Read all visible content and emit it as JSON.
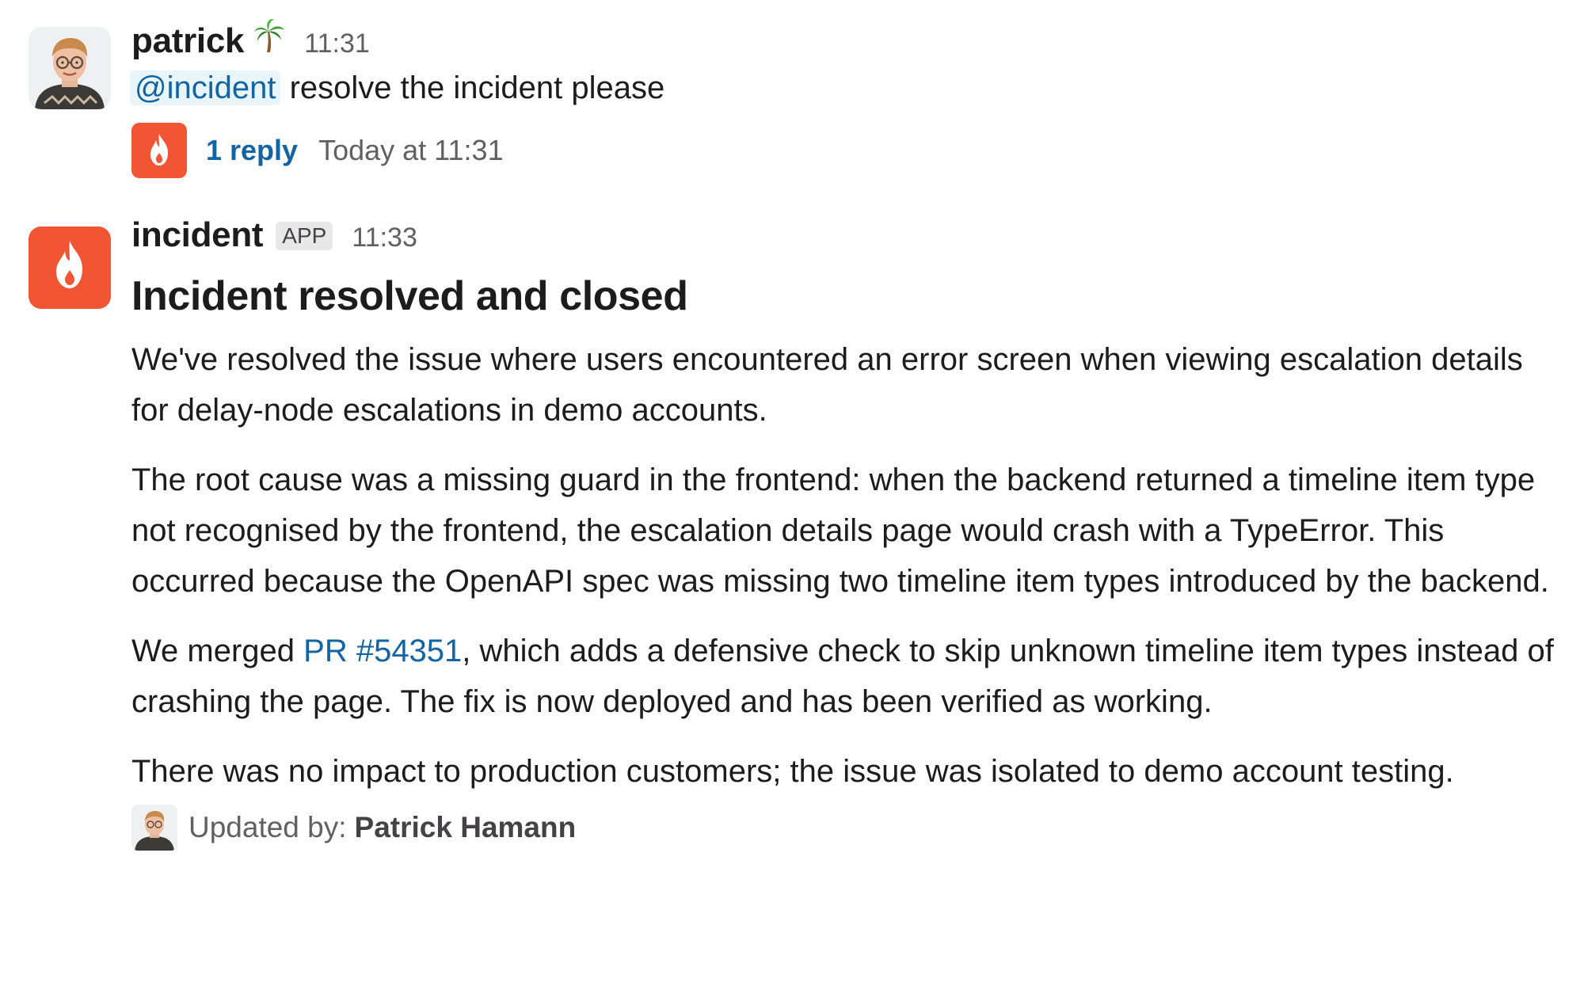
{
  "message_1": {
    "author": "patrick",
    "status_emoji": "palm-tree-icon",
    "time": "11:31",
    "mention": "@incident",
    "text": "resolve the incident please",
    "thread": {
      "reply_count": "1 reply",
      "last_reply": "Today at 11:31"
    }
  },
  "message_2": {
    "author": "incident",
    "badge": "APP",
    "time": "11:33",
    "heading": "Incident resolved and closed",
    "paragraphs": {
      "p1": "We've resolved the issue where users encountered an error screen when viewing escalation details for delay-node escalations in demo accounts.",
      "p2": "The root cause was a missing guard in the frontend: when the backend returned a timeline item type not recognised by the frontend, the escalation details page would crash with a TypeError. This occurred because the OpenAPI spec was missing two timeline item types introduced by the backend.",
      "p3_prefix": "We merged ",
      "p3_link": "PR #54351",
      "p3_suffix": ", which adds a defensive check to skip unknown timeline item types instead of crashing the page. The fix is now deployed and has been verified as working.",
      "p4": "There was no impact to production customers; the issue was isolated to demo account testing."
    },
    "updated_by_label": "Updated by:",
    "updated_by_name": "Patrick Hamann"
  },
  "colors": {
    "incident_orange": "#f25533",
    "link_blue": "#1264a3",
    "mention_bg": "#e8f5fa",
    "muted_text": "#616061"
  }
}
